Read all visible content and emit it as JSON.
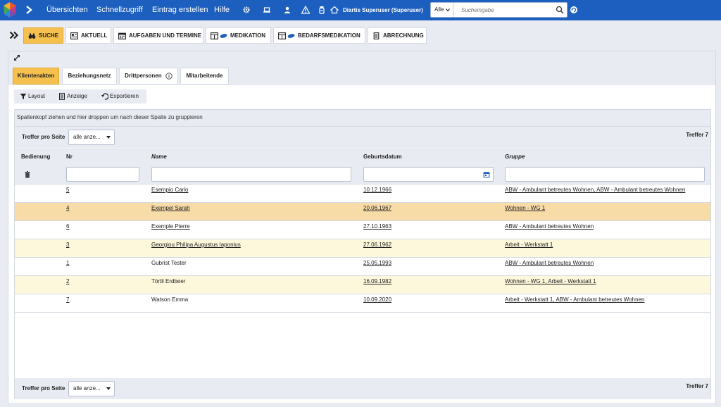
{
  "topbar": {
    "nav": [
      "Übersichten",
      "Schnellzugriff",
      "Eintrag erstellen",
      "Hilfe"
    ],
    "user": "Diartis Superuser (Superuser)",
    "search_scope": "Alle",
    "search_placeholder": "Sucheingabe"
  },
  "main_tabs": [
    {
      "label": "Suche",
      "icon": "binoculars-icon",
      "active": true
    },
    {
      "label": "Aktuell",
      "icon": "newspaper-icon"
    },
    {
      "label": "Aufgaben und Termine",
      "icon": "calendar-icon"
    },
    {
      "label": "Medikation",
      "icon": "pill-icon"
    },
    {
      "label": "Bedarfsmedikation",
      "icon": "pill-icon"
    },
    {
      "label": "Abrechnung",
      "icon": "receipt-icon"
    }
  ],
  "sub_tabs": [
    {
      "label": "Klientenakten",
      "active": true
    },
    {
      "label": "Beziehungsnetz"
    },
    {
      "label": "Drittpersonen"
    },
    {
      "label": "Mitarbeitende"
    }
  ],
  "toolbar": {
    "layout": "Layout",
    "anzeige": "Anzeige",
    "exportieren": "Exportieren"
  },
  "grid": {
    "group_hint": "Spaltenkopf ziehen und hier droppen um nach dieser Spalte zu gruppieren",
    "pager_label": "Treffer pro Seite",
    "pager_value": "alle anze...",
    "count": "Treffer 7",
    "columns": [
      "Bedienung",
      "Nr",
      "Name",
      "Geburtsdatum",
      "Gruppe"
    ],
    "rows": [
      {
        "nr": "5",
        "name": "Esempio Carlo",
        "geb": "10.12.1966",
        "gruppe": "ABW - Ambulant betreutes Wohnen, ABW - Ambulant betreutes Wohnen"
      },
      {
        "nr": "4",
        "name": "Exempel Sarah",
        "geb": "20.06.1967",
        "gruppe": "Wohnen - WG 1"
      },
      {
        "nr": "6",
        "name": "Exemple Pierre",
        "geb": "27.10.1963",
        "gruppe": "ABW - Ambulant betreutes Wohnen"
      },
      {
        "nr": "3",
        "name": "Georgiou Philipa Augustus Iaponius",
        "geb": "27.06.1962",
        "gruppe": "Arbeit - Werkstatt 1"
      },
      {
        "nr": "1",
        "name": "Gubrist Tester",
        "geb": "25.05.1993",
        "gruppe": "ABW - Ambulant betreutes Wohnen"
      },
      {
        "nr": "2",
        "name": "Törtli Erdbeer",
        "geb": "16.09.1982",
        "gruppe": "Wohnen - WG 1, Arbeit - Werkstatt 1"
      },
      {
        "nr": "7",
        "name": "Watson Emma",
        "geb": "10.09.2020",
        "gruppe": "Arbeit - Werkstatt 1, ABW - Ambulant betreutes Wohnen"
      }
    ]
  },
  "colors": {
    "topbar": "#1d5fbf",
    "active_tab": "#f5c04e",
    "selected_row": "#f8dca8",
    "alt_row": "#fdf8dc",
    "panel_bg": "#e8ebf2"
  }
}
